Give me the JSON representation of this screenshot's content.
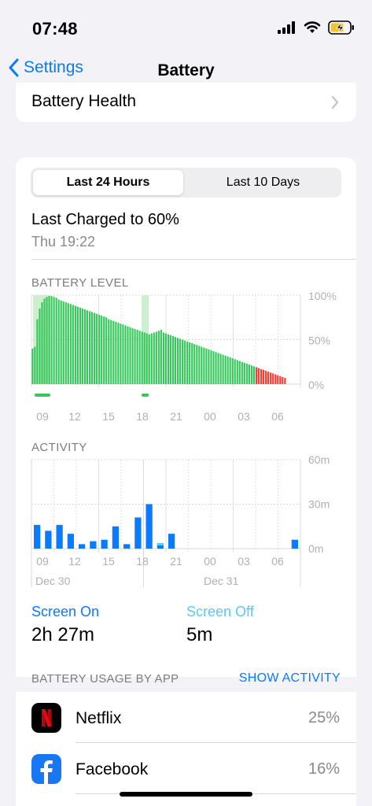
{
  "status": {
    "time": "07:48"
  },
  "nav": {
    "back_label": "Settings",
    "title": "Battery"
  },
  "battery_health": {
    "label": "Battery Health"
  },
  "segmented": {
    "options": [
      "Last 24 Hours",
      "Last 10 Days"
    ],
    "selected": 0
  },
  "last_charged": {
    "text": "Last Charged to 60%",
    "time": "Thu 19:22"
  },
  "colors": {
    "accent": "#0a7aff",
    "battery_green": "#34c759",
    "battery_red": "#ff3b30",
    "charging_bg": "#cdeecf",
    "screen_off": "#5ac8fa"
  },
  "chart_data": [
    {
      "type": "bar",
      "title": "BATTERY LEVEL",
      "x_tick_labels": [
        "09",
        "12",
        "15",
        "18",
        "21",
        "00",
        "03",
        "06"
      ],
      "y_tick_labels": [
        "100%",
        "50%",
        "0%"
      ],
      "ylim": [
        0,
        100
      ],
      "values": [
        40,
        42,
        73,
        85,
        92,
        96,
        98,
        99,
        99,
        98,
        97,
        95,
        94,
        93,
        92,
        91,
        90,
        89,
        88,
        87,
        86,
        85,
        84,
        83,
        82,
        81,
        80,
        79,
        78,
        77,
        76,
        75,
        73,
        72,
        71,
        70,
        69,
        68,
        67,
        66,
        65,
        64,
        63,
        62,
        61,
        60,
        59,
        58,
        57,
        56,
        57,
        58,
        59,
        60,
        61,
        58,
        57,
        56,
        55,
        54,
        53,
        52,
        51,
        50,
        49,
        48,
        47,
        46,
        45,
        44,
        43,
        42,
        41,
        40,
        39,
        38,
        37,
        36,
        35,
        34,
        33,
        32,
        31,
        30,
        29,
        28,
        27,
        26,
        25,
        24,
        23,
        22,
        21,
        20,
        19,
        18,
        17,
        16,
        15,
        14,
        13,
        12,
        11,
        10,
        9,
        8,
        7
      ],
      "low_battery_threshold": 20,
      "grid": true
    },
    {
      "type": "bar",
      "title": "ACTIVITY",
      "x_tick_labels": [
        "09",
        "12",
        "15",
        "18",
        "21",
        "00",
        "03",
        "06"
      ],
      "date_labels": [
        "Dec 30",
        "Dec 31"
      ],
      "y_tick_labels": [
        "60m",
        "30m",
        "0m"
      ],
      "ylim": [
        0,
        60
      ],
      "series": [
        {
          "name": "Screen On",
          "values": [
            16,
            12,
            16,
            10,
            3,
            5,
            6,
            15,
            3,
            21,
            30,
            3,
            10,
            0,
            0,
            0,
            0,
            0,
            0,
            0,
            0,
            0,
            0,
            6
          ]
        },
        {
          "name": "Screen Off",
          "values": [
            0,
            0,
            0,
            0,
            0,
            0,
            0,
            0,
            0,
            0,
            0,
            1,
            0,
            0,
            0,
            0,
            0,
            0,
            0,
            0,
            0,
            0,
            0,
            0
          ]
        }
      ],
      "grid": true
    }
  ],
  "screen_on": {
    "label": "Screen On",
    "value": "2h 27m"
  },
  "screen_off": {
    "label": "Screen Off",
    "value": "5m"
  },
  "usage": {
    "header": "BATTERY USAGE BY APP",
    "show_activity": "SHOW ACTIVITY"
  },
  "apps": [
    {
      "name": "Netflix",
      "percent": "25%",
      "icon": "netflix-icon"
    },
    {
      "name": "Facebook",
      "percent": "16%",
      "icon": "facebook-icon"
    }
  ]
}
